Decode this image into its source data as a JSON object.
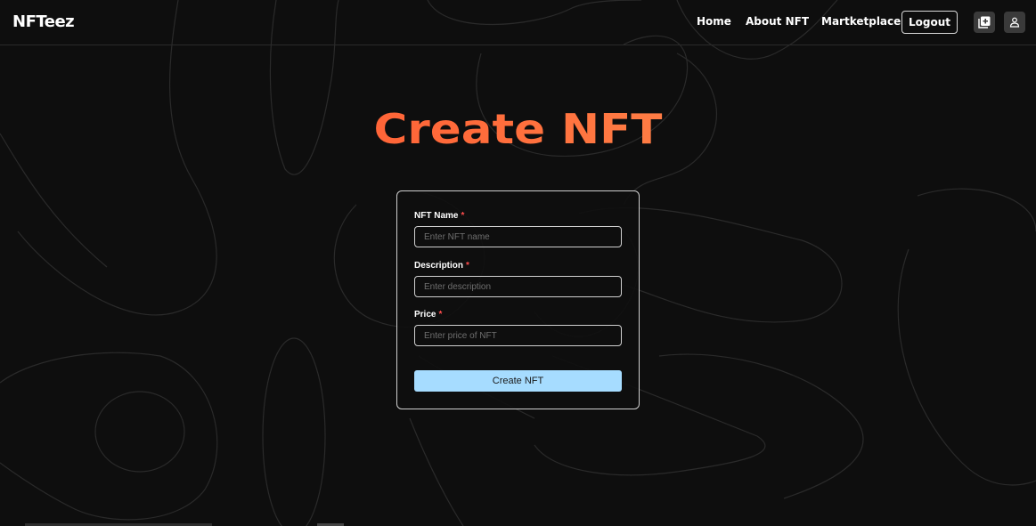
{
  "brand": {
    "name": "NFTeez"
  },
  "nav": {
    "home": "Home",
    "about": "About NFT",
    "marketplace": "Martketplace",
    "logout": "Logout",
    "icons": [
      "add-square-icon",
      "user-icon"
    ]
  },
  "page": {
    "title": "Create NFT"
  },
  "form": {
    "name_label": "NFT Name",
    "name_placeholder": "Enter NFT name",
    "name_value": "",
    "description_label": "Description",
    "description_placeholder": "Enter description",
    "description_value": "",
    "price_label": "Price",
    "price_placeholder": "Enter price of NFT",
    "price_value": "",
    "required_marker": "*",
    "submit_label": "Create NFT"
  },
  "colors": {
    "background": "#0e0e0e",
    "title_gradient_start": "#ff4a2b",
    "title_gradient_end": "#ffa45a",
    "submit_button": "#a6dcff",
    "required": "#ff4d4d"
  }
}
